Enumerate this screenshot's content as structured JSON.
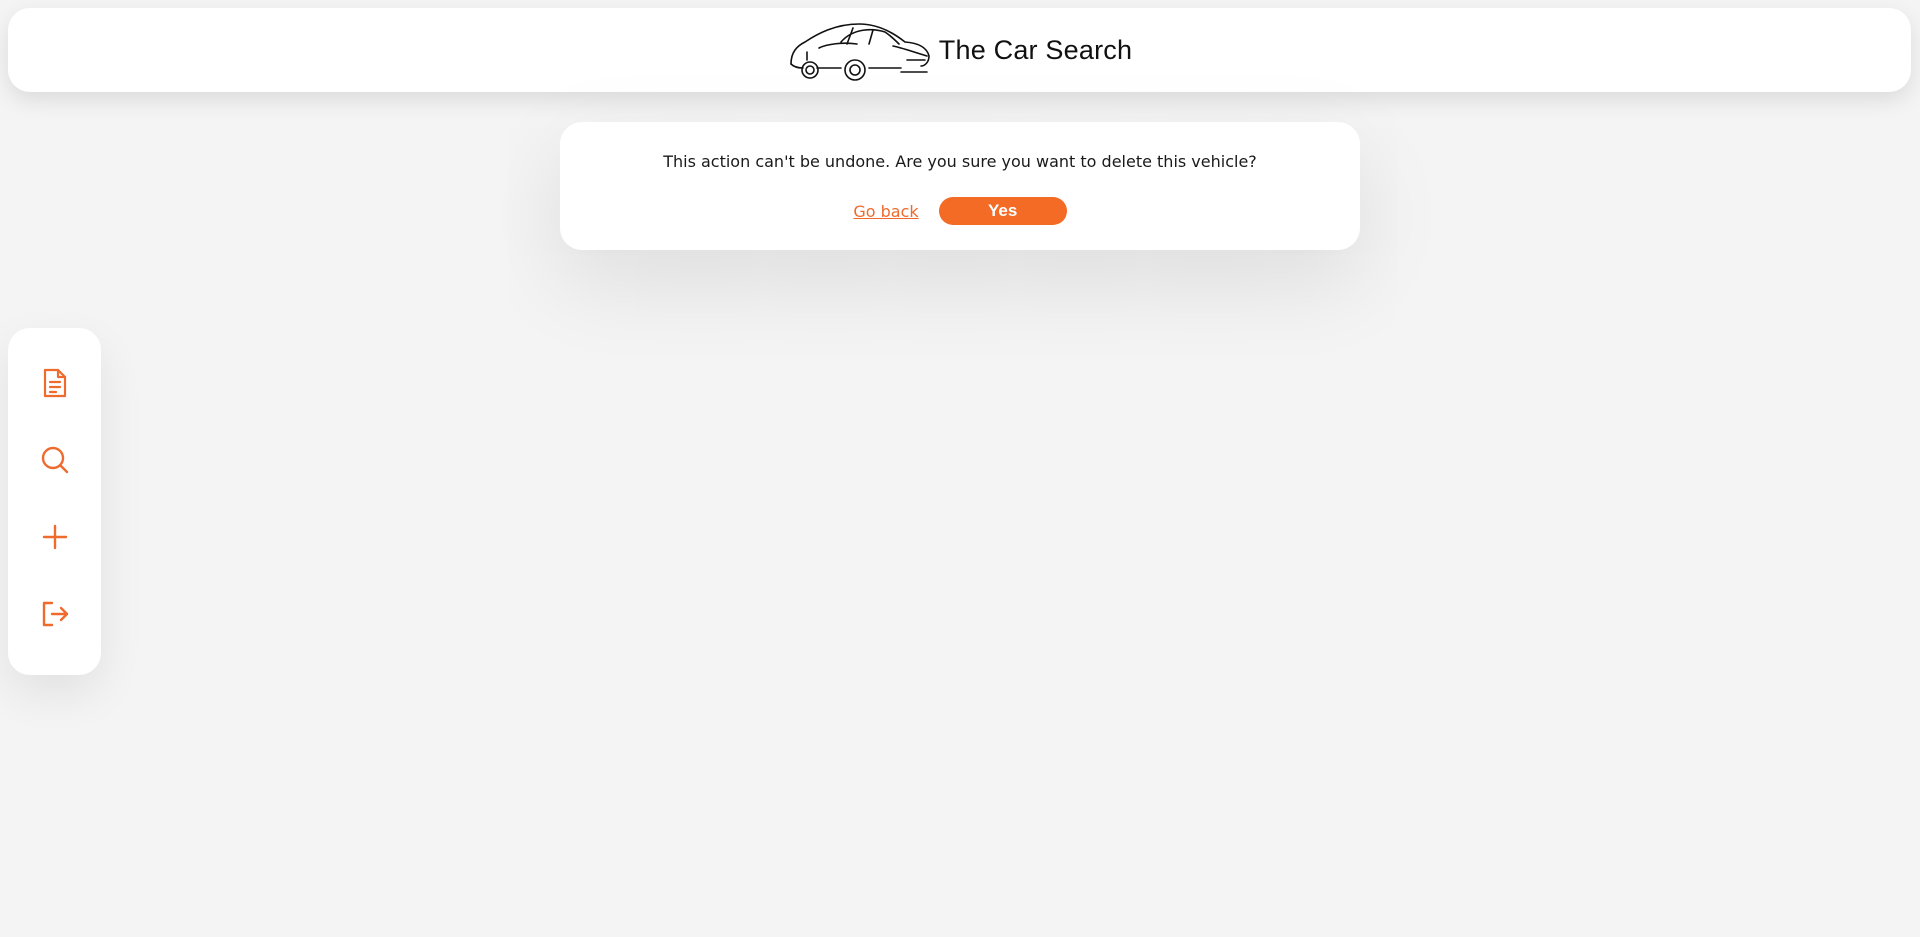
{
  "header": {
    "title": "The Car Search",
    "logo_icon": "car-outline-icon"
  },
  "dialog": {
    "message": "This action can't be undone. Are you sure you want to delete this vehicle?",
    "back_label": "Go back",
    "confirm_label": "Yes"
  },
  "sidebar": {
    "items": [
      {
        "icon": "document-icon"
      },
      {
        "icon": "search-icon"
      },
      {
        "icon": "plus-icon"
      },
      {
        "icon": "logout-icon"
      }
    ]
  },
  "colors": {
    "accent": "#f36b24",
    "background": "#f4f4f4",
    "surface": "#ffffff",
    "text": "#1a1a1a"
  }
}
